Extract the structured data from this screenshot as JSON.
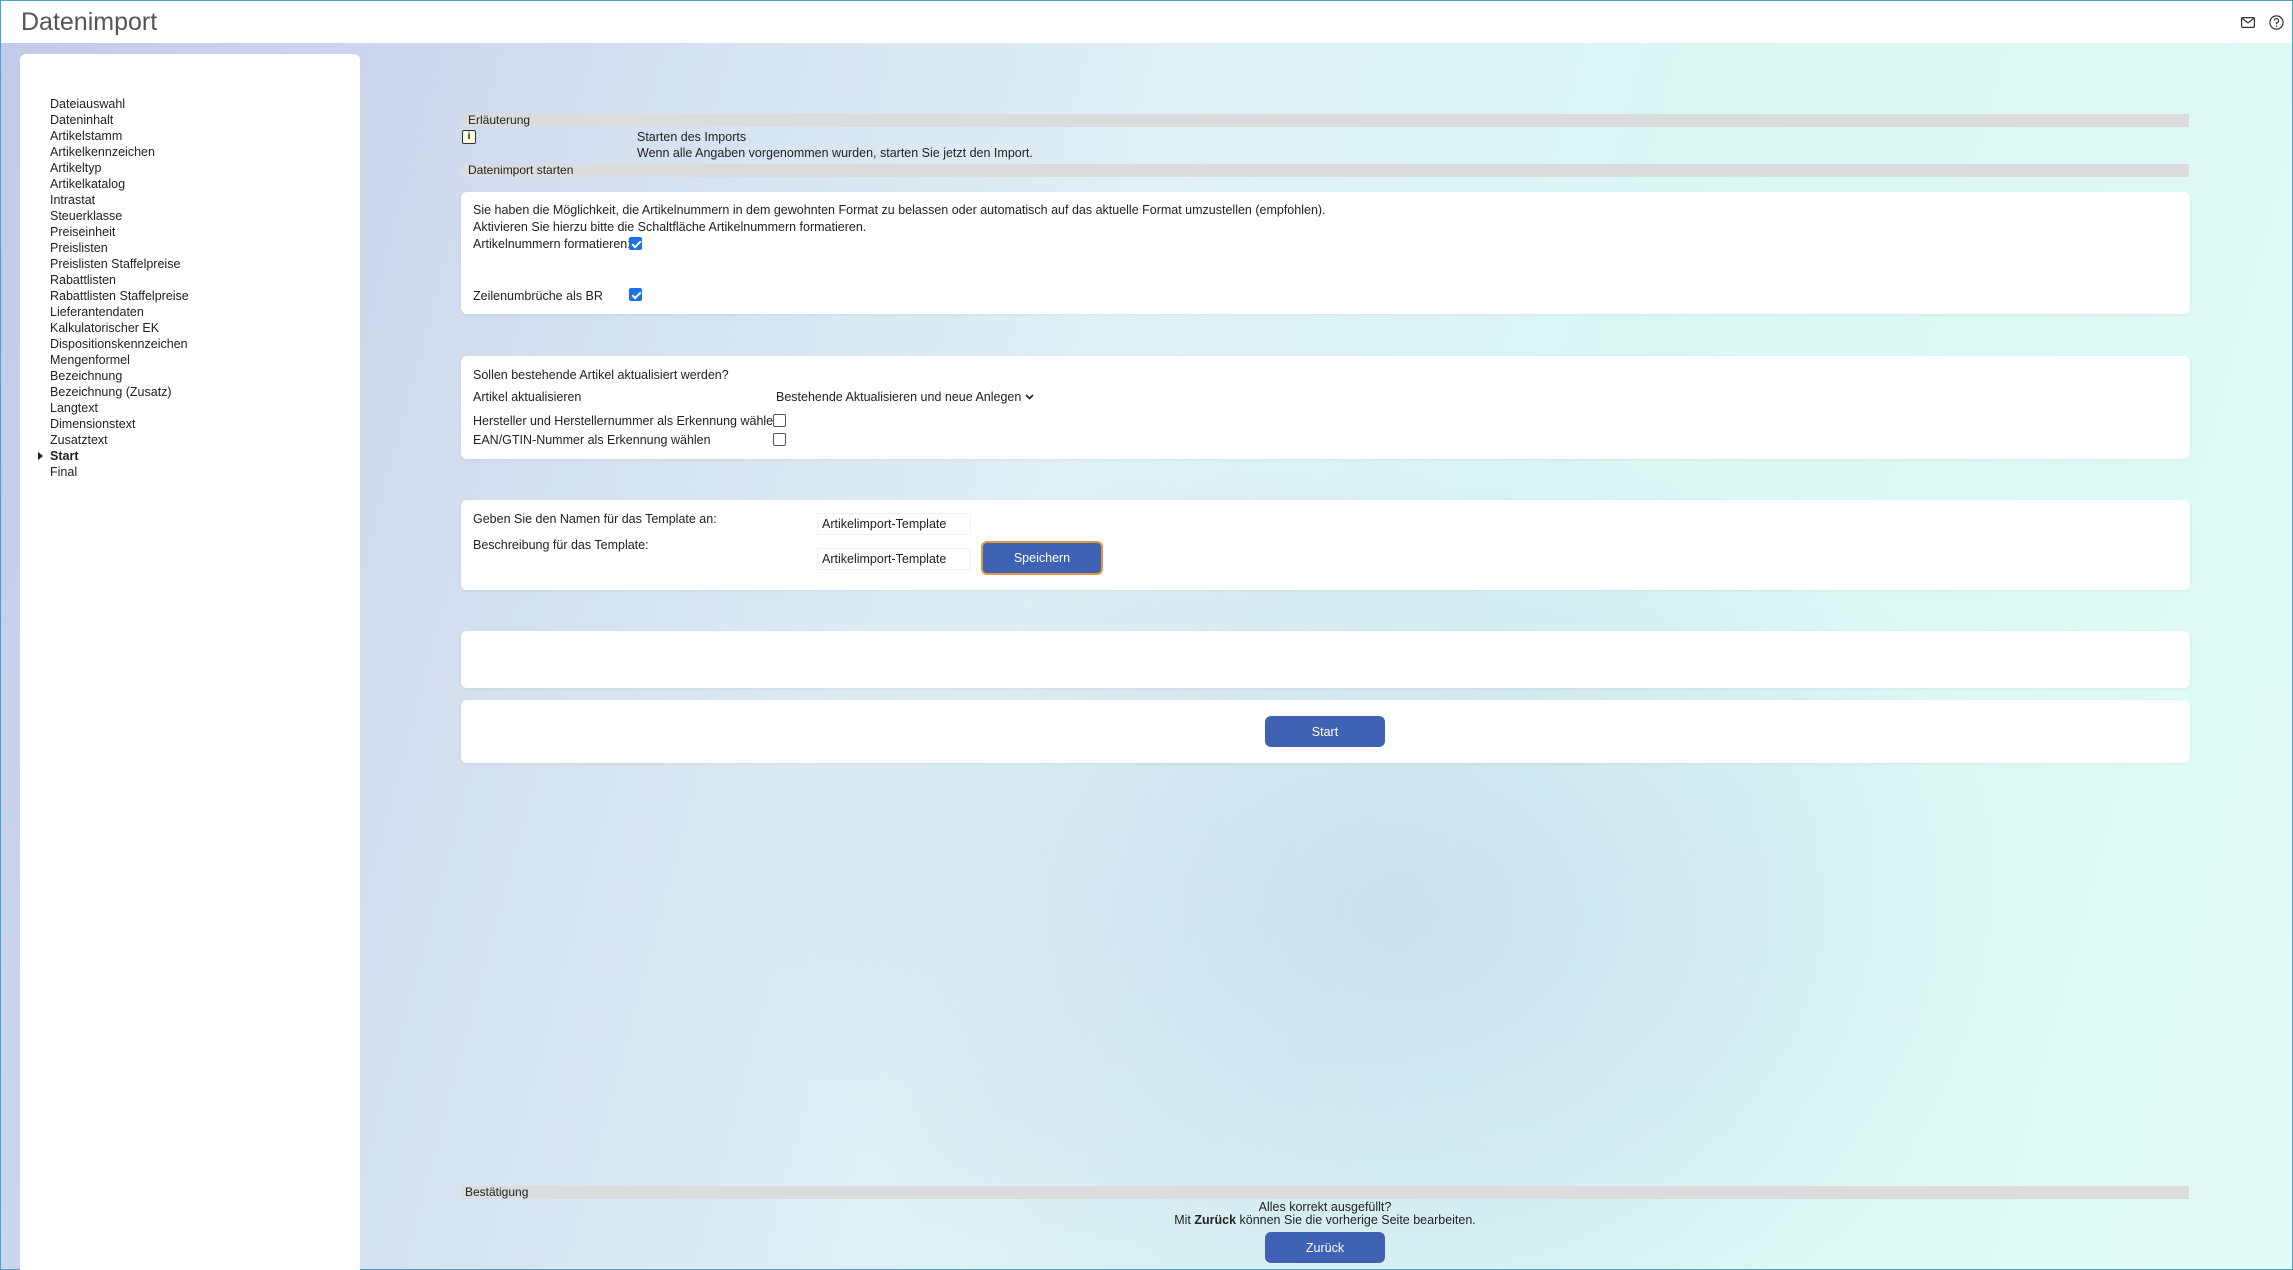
{
  "header": {
    "title": "Datenimport",
    "icons": [
      "mail-icon",
      "help-icon"
    ]
  },
  "sidebar": {
    "items": [
      "Dateiauswahl",
      "Dateninhalt",
      "Artikelstamm",
      "Artikelkennzeichen",
      "Artikeltyp",
      "Artikelkatalog",
      "Intrastat",
      "Steuerklasse",
      "Preiseinheit",
      "Preislisten",
      "Preislisten Staffelpreise",
      "Rabattlisten",
      "Rabattlisten Staffelpreise",
      "Lieferantendaten",
      "Kalkulatorischer EK",
      "Dispositionskennzeichen",
      "Mengenformel",
      "Bezeichnung",
      "Bezeichnung (Zusatz)",
      "Langtext",
      "Dimensionstext",
      "Zusatztext",
      "Start",
      "Final"
    ],
    "active_index": 22
  },
  "explanation": {
    "heading": "Erläuterung",
    "title": "Starten des Imports",
    "text": "Wenn alle Angaben vorgenommen wurden, starten Sie jetzt den Import."
  },
  "start_section": {
    "heading": "Datenimport starten"
  },
  "format_panel": {
    "line1": "Sie haben die Möglichkeit, die Artikelnummern in dem gewohnten Format zu belassen oder automatisch auf das aktuelle Format umzustellen (empfohlen).",
    "line2": "Aktivieren Sie hierzu bitte die Schaltfläche Artikelnummern formatieren.",
    "format_label": "Artikelnummern formatieren:",
    "format_checked": true,
    "linebreak_label": "Zeilenumbrüche als BR",
    "linebreak_checked": true
  },
  "update_panel": {
    "question": "Sollen bestehende Artikel aktualisiert werden?",
    "update_label": "Artikel aktualisieren",
    "update_value": "Bestehende Aktualisieren und neue Anlegen",
    "manufacturer_label": "Hersteller und Herstellernummer als Erkennung wählen",
    "manufacturer_checked": false,
    "ean_label": "EAN/GTIN-Nummer als Erkennung wählen",
    "ean_checked": false
  },
  "template_panel": {
    "name_label": "Geben Sie den Namen für das Template an:",
    "name_value": "Artikelimport-Template",
    "desc_label": "Beschreibung für das Template:",
    "desc_value": "Artikelimport-Template",
    "save_label": "Speichern"
  },
  "start_button": {
    "label": "Start"
  },
  "confirmation": {
    "heading": "Bestätigung",
    "question": "Alles korrekt ausgefüllt?",
    "hint_prefix": "Mit ",
    "hint_bold": "Zurück",
    "hint_suffix": " können Sie die vorherige Seite bearbeiten.",
    "back_label": "Zurück"
  },
  "colors": {
    "primary_button": "#4062b5",
    "focus_border": "#e09a3e",
    "checkbox": "#1a73e8"
  }
}
